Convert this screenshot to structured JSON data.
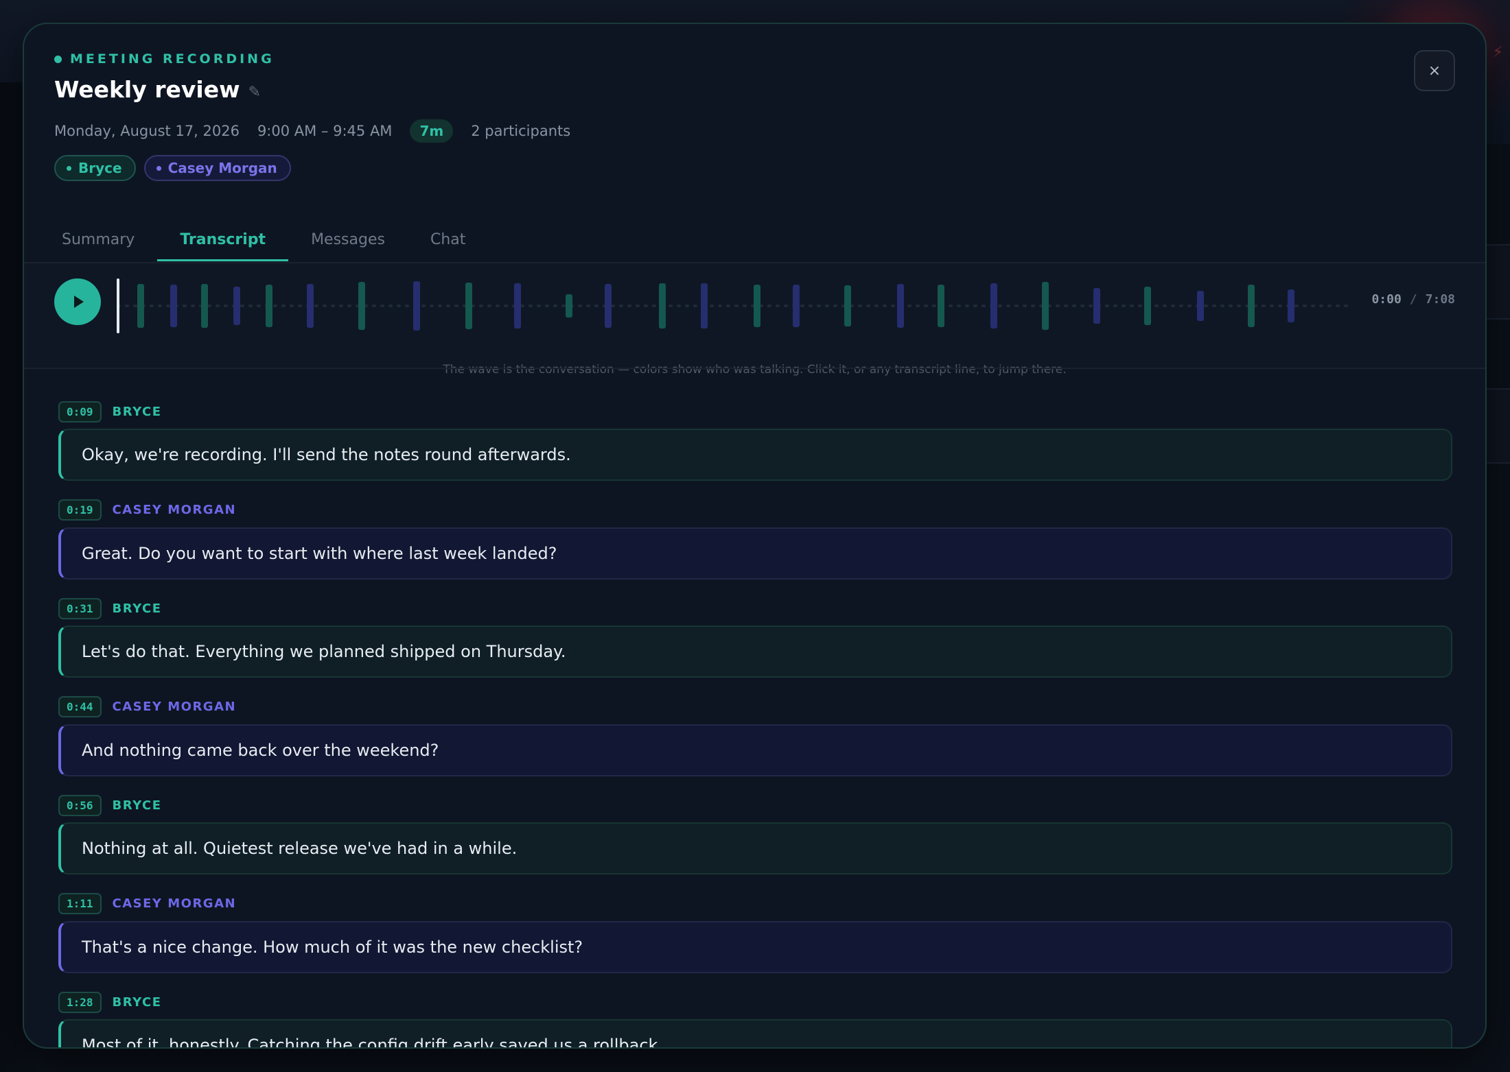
{
  "modal": {
    "eyebrow": "MEETING RECORDING",
    "title": "Weekly review",
    "date": "Monday, August 17, 2026",
    "time_range": "9:00 AM – 9:45 AM",
    "duration": "7m",
    "participants_count": "2 participants",
    "close_label": "×",
    "edit_icon": "pencil-icon",
    "participants": [
      {
        "name": "Bryce",
        "color": "#2fc0a6"
      },
      {
        "name": "Casey Morgan",
        "color": "#7a74ea"
      }
    ]
  },
  "tabs": [
    {
      "label": "Summary",
      "active": false
    },
    {
      "label": "Transcript",
      "active": true
    },
    {
      "label": "Messages",
      "active": false
    },
    {
      "label": "Chat",
      "active": false
    }
  ],
  "player": {
    "current_time": "0:00",
    "separator": "/",
    "total_time": "7:08",
    "hint": "The wave is the conversation — colors show who was talking. Click it, or any transcript line, to jump there."
  },
  "colors": {
    "bryce": "#2fc0a6",
    "casey": "#6d68e8",
    "accent": "#27b49c"
  },
  "transcript": [
    {
      "time": "0:09",
      "speaker": "BRYCE",
      "who": "b",
      "text": "Okay, we're recording. I'll send the notes round afterwards."
    },
    {
      "time": "0:19",
      "speaker": "CASEY MORGAN",
      "who": "c",
      "text": "Great. Do you want to start with where last week landed?"
    },
    {
      "time": "0:31",
      "speaker": "BRYCE",
      "who": "b",
      "text": "Let's do that. Everything we planned shipped on Thursday."
    },
    {
      "time": "0:44",
      "speaker": "CASEY MORGAN",
      "who": "c",
      "text": "And nothing came back over the weekend?"
    },
    {
      "time": "0:56",
      "speaker": "BRYCE",
      "who": "b",
      "text": "Nothing at all. Quietest release we've had in a while."
    },
    {
      "time": "1:11",
      "speaker": "CASEY MORGAN",
      "who": "c",
      "text": "That's a nice change. How much of it was the new checklist?"
    },
    {
      "time": "1:28",
      "speaker": "BRYCE",
      "who": "b",
      "text": "Most of it, honestly. Catching the config drift early saved us a rollback."
    }
  ]
}
